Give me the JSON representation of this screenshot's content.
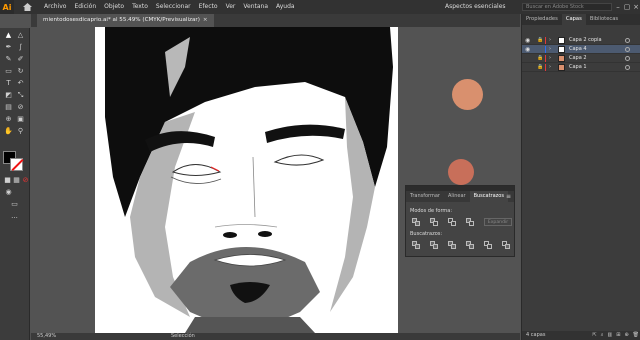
{
  "app": {
    "logo": "Ai",
    "menu": [
      "Archivo",
      "Edición",
      "Objeto",
      "Texto",
      "Seleccionar",
      "Efecto",
      "Ver",
      "Ventana",
      "Ayuda"
    ],
    "workspace": "Aspectos esenciales",
    "stock_search_placeholder": "Buscar en Adobe Stock"
  },
  "document": {
    "tab_title": "mientodosesdicaprio.ai* al 55.49% (CMYK/Previsualizar)",
    "close": "×"
  },
  "status": {
    "zoom": "55,49%",
    "mode": "Selección"
  },
  "layers_panel": {
    "tabs": [
      "Propiedades",
      "Capas",
      "Bibliotecas"
    ],
    "active_tab": "Capas",
    "layers": [
      {
        "name": "Capa 2 copia",
        "color": "#e03a3a",
        "selected": false
      },
      {
        "name": "Capa 4",
        "color": "#2f6ff0",
        "selected": true
      },
      {
        "name": "Capa 2",
        "color": "#e03a3a",
        "selected": false
      },
      {
        "name": "Capa 1",
        "color": "#e03a3a",
        "selected": false
      }
    ],
    "footer_count": "4 capas"
  },
  "pathfinder_panel": {
    "tabs": [
      "Transformar",
      "Alinear",
      "Buscatrazos"
    ],
    "active_tab": "Buscatrazos",
    "shape_modes_label": "Modos de forma:",
    "pathfinders_label": "Buscatrazos:",
    "expand_label": "Expandir"
  },
  "colors": {
    "swatch_top": "#d9906e",
    "swatch_bottom": "#c86f5a",
    "accent": "#ff9a00"
  }
}
